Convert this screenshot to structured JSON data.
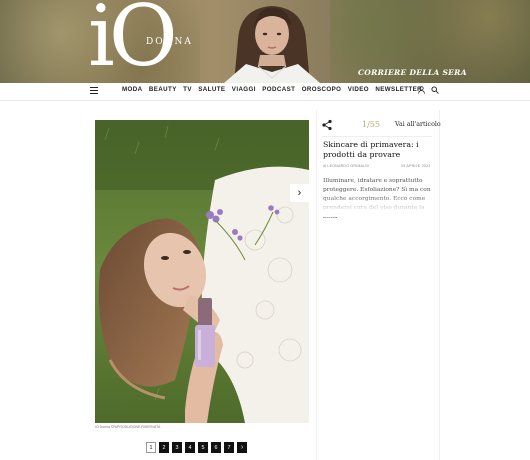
{
  "header": {
    "logo_big": "iO",
    "logo_small": "DONNA",
    "publisher": "CORRIERE DELLA SERA"
  },
  "nav": {
    "items": [
      "MODA",
      "BEAUTY",
      "TV",
      "SALUTE",
      "VIAGGI",
      "PODCAST",
      "OROSCOPO",
      "VIDEO",
      "NEWSLETTER"
    ],
    "icons": [
      "menu-icon",
      "user-icon",
      "search-icon"
    ]
  },
  "gallery": {
    "counter": "1/55",
    "goto_article": "Vai all'articolo",
    "title": "Skincare di primavera: i prodotti da provare",
    "author": "di LEONARDO GRIMALDI",
    "date": "15 APRILE 2023",
    "description": "Illuminare, idratare e soprattutto proteggere. Esfoliazione? Sì ma con qualche accorgimento. Ecco come prendersi cura del viso durante la bella",
    "photo_credit": "IO Donna ©RIPRODUZIONE RISERVATA"
  },
  "pagination": {
    "pages": [
      "1",
      "2",
      "3",
      "4",
      "5",
      "6",
      "7"
    ],
    "active": "1",
    "next": "›"
  }
}
